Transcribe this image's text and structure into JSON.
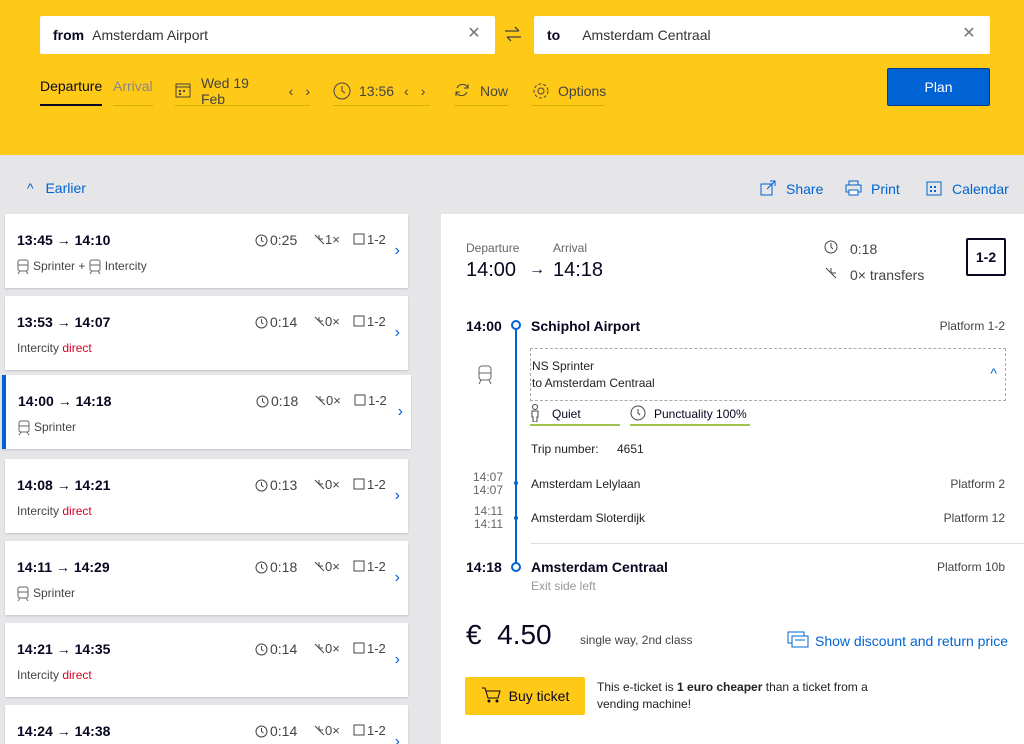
{
  "search": {
    "from_label": "from",
    "from_value": "Amsterdam Airport",
    "to_label": "to",
    "to_value": "Amsterdam Centraal",
    "tab_departure": "Departure",
    "tab_arrival": "Arrival",
    "date": "Wed 19 Feb",
    "time": "13:56",
    "now": "Now",
    "options": "Options",
    "plan": "Plan"
  },
  "toolbar": {
    "earlier": "Earlier",
    "share": "Share",
    "print": "Print",
    "calendar": "Calendar"
  },
  "trips": [
    {
      "times": "13:45 → 14:10",
      "duration": "0:25",
      "transfers": "1×",
      "platform": "1-2",
      "sub_a": "Sprinter",
      "sub_b": "Intercity",
      "direct": ""
    },
    {
      "times": "13:53 → 14:07",
      "duration": "0:14",
      "transfers": "0×",
      "platform": "1-2",
      "sub_a": "Intercity",
      "sub_b": "",
      "direct": "direct"
    },
    {
      "times": "14:00 → 14:18",
      "duration": "0:18",
      "transfers": "0×",
      "platform": "1-2",
      "sub_a": "Sprinter",
      "sub_b": "",
      "direct": ""
    },
    {
      "times": "14:08 → 14:21",
      "duration": "0:13",
      "transfers": "0×",
      "platform": "1-2",
      "sub_a": "Intercity",
      "sub_b": "",
      "direct": "direct"
    },
    {
      "times": "14:11 → 14:29",
      "duration": "0:18",
      "transfers": "0×",
      "platform": "1-2",
      "sub_a": "Sprinter",
      "sub_b": "",
      "direct": ""
    },
    {
      "times": "14:21 → 14:35",
      "duration": "0:14",
      "transfers": "0×",
      "platform": "1-2",
      "sub_a": "Intercity",
      "sub_b": "",
      "direct": "direct"
    },
    {
      "times": "14:24 → 14:38",
      "duration": "0:14",
      "transfers": "0×",
      "platform": "1-2",
      "sub_a": "",
      "sub_b": "",
      "direct": ""
    }
  ],
  "detail": {
    "departure_label": "Departure",
    "arrival_label": "Arrival",
    "departure_time": "14:00",
    "arrival_time": "14:18",
    "duration": "0:18",
    "transfers": "0× transfers",
    "platform_badge": "1-2",
    "origin_time": "14:00",
    "origin_name": "Schiphol Airport",
    "origin_platform": "Platform 1-2",
    "train_name": "NS Sprinter",
    "train_direction": "to Amsterdam Centraal",
    "quiet": "Quiet",
    "punctuality": "Punctuality 100%",
    "trip_number_label": "Trip number:",
    "trip_number": "4651",
    "stop1_arr": "14:07",
    "stop1_dep": "14:07",
    "stop1_name": "Amsterdam Lelylaan",
    "stop1_platform": "Platform 2",
    "stop2_arr": "14:11",
    "stop2_dep": "14:11",
    "stop2_name": "Amsterdam Sloterdijk",
    "stop2_platform": "Platform 12",
    "dest_time": "14:18",
    "dest_name": "Amsterdam Centraal",
    "dest_platform": "Platform 10b",
    "dest_note": "Exit side left",
    "price": "€  4.50",
    "price_note": "single way, 2nd class",
    "discount_link": "Show discount and return price",
    "buy": "Buy ticket",
    "eticket_pre": "This e-ticket is",
    "eticket_bold": "1 euro cheaper",
    "eticket_post": "than a ticket from a vending machine!"
  },
  "colors": {
    "yellow": "#ffc917",
    "blue": "#0063d3",
    "red": "#db0029",
    "navy": "#070721"
  }
}
